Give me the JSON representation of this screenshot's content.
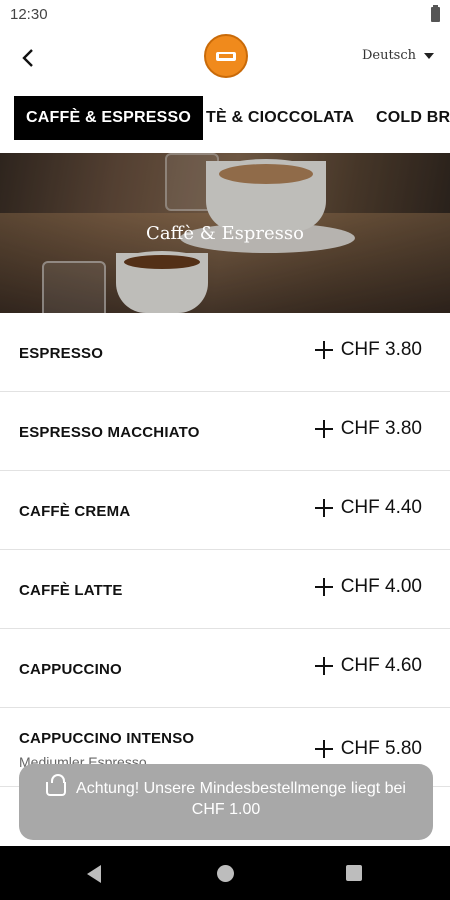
{
  "status_bar": {
    "time": "12:30"
  },
  "header": {
    "language": "Deutsch"
  },
  "tabs": [
    {
      "label": "CAFFÈ & ESPRESSO",
      "active": true
    },
    {
      "label": "TÈ & CIOCCOLATA",
      "active": false
    },
    {
      "label": "COLD BRE",
      "active": false
    }
  ],
  "hero": {
    "title": "Caffè & Espresso"
  },
  "products": [
    {
      "name": "ESPRESSO",
      "price": "CHF 3.80"
    },
    {
      "name": "ESPRESSO MACCHIATO",
      "price": "CHF 3.80"
    },
    {
      "name": "CAFFÈ CREMA",
      "price": "CHF 4.40"
    },
    {
      "name": "CAFFÈ LATTE",
      "price": "CHF 4.00"
    },
    {
      "name": "CAPPUCCINO",
      "price": "CHF 4.60"
    },
    {
      "name": "CAPPUCCINO INTENSO",
      "sub": "Mediumler Espresso",
      "price": "CHF 5.80"
    }
  ],
  "toast": {
    "line1": "Achtung! Unsere Mindesbestellmenge liegt bei",
    "line2": "CHF 1.00"
  },
  "colors": {
    "accent": "#f08a1c",
    "tab_active_bg": "#000000",
    "toast_bg": "#a8a8a8"
  },
  "icons": [
    "back-icon",
    "caret-down-icon",
    "plus-icon",
    "basket-icon",
    "nav-back-icon",
    "nav-home-icon",
    "nav-recents-icon",
    "battery-icon"
  ]
}
